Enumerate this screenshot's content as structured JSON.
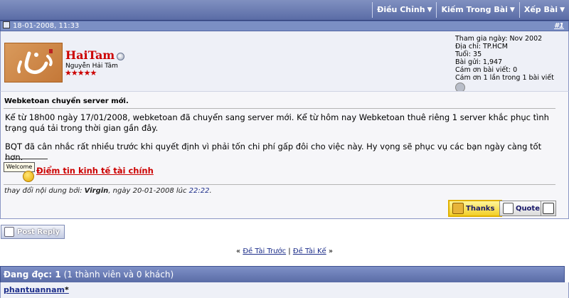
{
  "toolbar": {
    "items": [
      {
        "label": "Điều Chỉnh"
      },
      {
        "label": "Kiếm Trong Bài"
      },
      {
        "label": "Xếp Bài"
      }
    ]
  },
  "post": {
    "date": "18-01-2008, 11:33",
    "number": "#1",
    "title": "Webketoan chuyển server mới.",
    "paragraphs": [
      "Kể từ 18h00 ngày 17/01/2008, webketoan đã chuyển sang server mới. Kể từ hôm nay Webketoan thuê riêng 1 server khắc phục tình trạng quá tải trong thời gian gần đây.",
      "BQT đã cân nhắc rất nhiều trước khi quyết định vì phải tốn chi phí gấp đôi cho việc này. Hy vọng sẽ phục vụ các bạn ngày càng tốt hơn."
    ],
    "signature": {
      "badge": "Welcome",
      "link": "Điểm tin kinh tế tài chính"
    },
    "edited": {
      "prefix": "thay đổi nội dung bởi: ",
      "by": "Virgin",
      "middle": ", ngày 20-01-2008 lúc ",
      "time": "22:22",
      "suffix": "."
    }
  },
  "user": {
    "name": "HaiTam",
    "real_name": "Nguyễn Hải Tâm",
    "stars": "★★★★★",
    "join": "Tham gia ngày: Nov 2002",
    "location": "Địa chỉ: TP.HCM",
    "age": "Tuổi: 35",
    "posts": "Bài gửi: 1,947",
    "thanks_received": "Cám ơn bài viết: 0",
    "thanked_times": "Cám ơn 1 lần trong 1 bài viết"
  },
  "buttons": {
    "thanks": "Thanks",
    "quote": "Quote",
    "post_reply": "Post Reply"
  },
  "navigation": {
    "prefix": "« ",
    "prev": "Đề Tài Trước",
    "sep": " | ",
    "next": "Đề Tài Kế",
    "suffix": " »"
  },
  "readers": {
    "heading_bold": "Đang đọc: 1",
    "heading_rest": " (1 thành viên và 0 khách)",
    "list": [
      {
        "name": "phantuannam",
        "suffix": "*"
      }
    ]
  },
  "colors": {
    "header": "#5a6ca6",
    "accent_red": "#cc0000",
    "link": "#1d2e8a",
    "thanks_bg": "#f2cf2a"
  }
}
